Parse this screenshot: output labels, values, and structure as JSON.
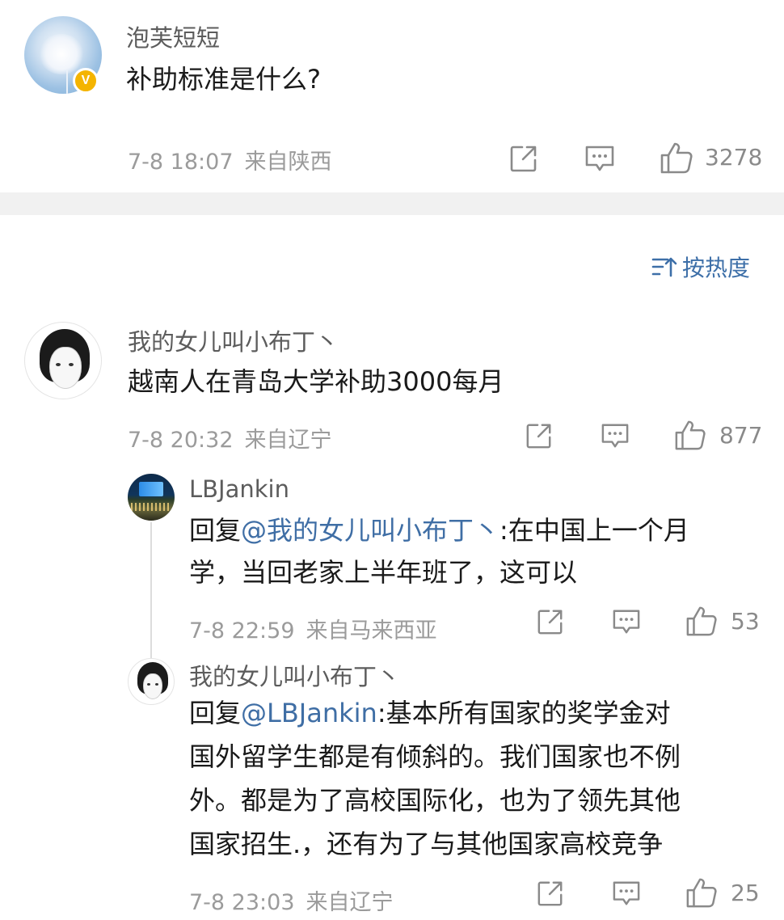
{
  "post": {
    "username": "泡芙短短",
    "text": "补助标准是什么?",
    "time": "7-8 18:07",
    "location": "来自陕西",
    "likes": "3278",
    "verified_badge": "V",
    "share_icon": "share-icon",
    "comment_icon": "comment-icon",
    "like_icon": "thumbs-up-icon"
  },
  "sort": {
    "label": "按热度",
    "icon": "sort-icon",
    "accent_color": "#3d6fa8"
  },
  "comments": [
    {
      "username": "我的女儿叫小布丁丶",
      "text": "越南人在青岛大学补助3000每月",
      "time": "7-8 20:32",
      "location": "来自辽宁",
      "likes": "877",
      "replies": [
        {
          "username": "LBJankin",
          "reply_prefix": "回复",
          "mention": "@我的女儿叫小布丁丶",
          "text_lines": [
            ":在中国上一个月",
            "学，当回老家上半年班了，这可以"
          ],
          "time": "7-8 22:59",
          "location": "来自马来西亚",
          "likes": "53"
        },
        {
          "username": "我的女儿叫小布丁丶",
          "reply_prefix": "回复",
          "mention": "@LBJankin",
          "text_lines": [
            ":基本所有国家的奖学金对",
            "国外留学生都是有倾斜的。我们国家也不例",
            "外。都是为了高校国际化，也为了领先其他",
            "国家招生.，还有为了与其他国家高校竞争"
          ],
          "time": "7-8 23:03",
          "location": "来自辽宁",
          "likes": "25"
        }
      ]
    }
  ],
  "colors": {
    "mention": "#3f6ea5",
    "meta": "#9b9b9b",
    "divider": "#f1f1f1",
    "verified": "#f4b400"
  }
}
